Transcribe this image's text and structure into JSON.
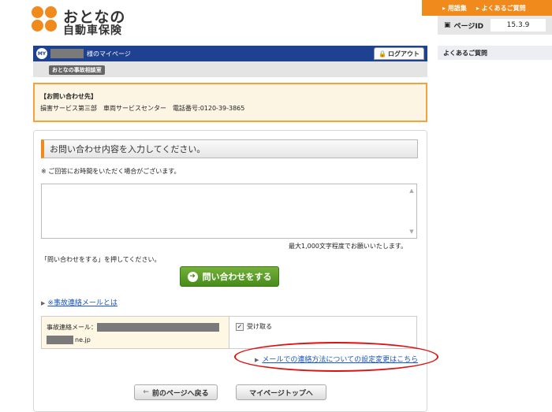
{
  "logo": {
    "line1": "おとなの",
    "line2": "自動車保険"
  },
  "toplinks": {
    "glossary": "用語集",
    "faq": "よくあるご質問"
  },
  "page_id": {
    "label": "ページID",
    "value": "15.3.9"
  },
  "side": {
    "faq_title": "よくあるご質問"
  },
  "mypage_bar": {
    "my_badge": "MY",
    "title": "様のマイページ",
    "logout": "ログアウト"
  },
  "subbar": {
    "tag": "おとなの事故相談室"
  },
  "contact": {
    "heading": "【お問い合わせ先】",
    "detail": "損害サービス第三部　車両サービスセンター　電話番号:0120-39-3865"
  },
  "form": {
    "heading": "お問い合わせ内容を入力してください。",
    "note": "※ ご回答にお時間をいただく場合がございます。",
    "textarea_value": "",
    "limit": "最大1,000文字程度でお願いいたします。",
    "press_instruction": "「問い合わせをする」を押してください。",
    "submit_label": "問い合わせをする"
  },
  "accident_link": "※事故連絡メールとは",
  "mail": {
    "label": "事故連絡メール：",
    "domain": "ne.jp",
    "receive_label": "受け取る",
    "receive_checked": true
  },
  "settings_link": "メールでの連絡方法についての設定変更はこちら",
  "nav": {
    "back": "前のページへ戻る",
    "top": "マイページトップへ"
  },
  "colors": {
    "accent": "#f08a1c",
    "navy": "#1e4290",
    "submit": "#478c1a",
    "highlight": "#e01010"
  }
}
